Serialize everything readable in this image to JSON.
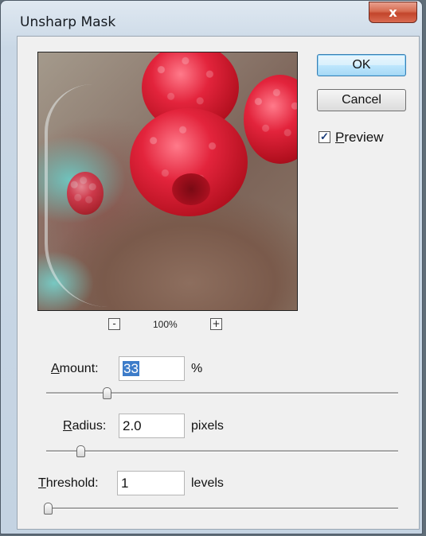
{
  "dialog": {
    "title": "Unsharp Mask",
    "close_label": "x"
  },
  "preview_image": {
    "description_icon": "raspberries-preview-image"
  },
  "zoom": {
    "zoom_out": "-",
    "zoom_in": "+",
    "level": "100%"
  },
  "buttons": {
    "ok": "OK",
    "cancel": "Cancel"
  },
  "preview_checkbox": {
    "checked": true,
    "underlined_letter": "P",
    "rest": "review"
  },
  "amount": {
    "underlined_letter": "A",
    "rest": "mount:",
    "value": "33",
    "unit": "%",
    "slider_fraction": 0.17
  },
  "radius": {
    "underlined_letter": "R",
    "rest": "adius:",
    "value": "2.0",
    "unit": "pixels",
    "slider_fraction": 0.1
  },
  "threshold": {
    "underlined_letter": "T",
    "rest": "hreshold:",
    "value": "1",
    "unit": "levels",
    "slider_fraction": 0.0
  },
  "colors": {
    "close_button": "#c9472b",
    "default_button": "#bee6fd",
    "selection": "#3d7cc9"
  }
}
